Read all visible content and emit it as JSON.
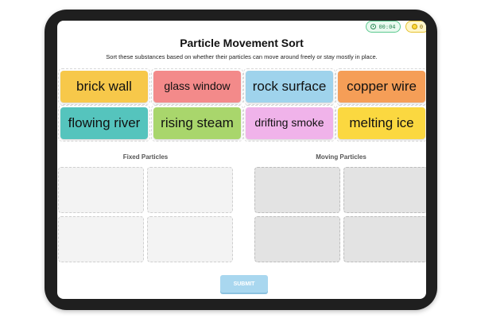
{
  "header": {
    "timer": "00:04",
    "coins": "0",
    "title": "Particle Movement Sort",
    "subtitle": "Sort these substances based on whether their particles can move around freely or stay mostly in place."
  },
  "cards": [
    {
      "label": "brick wall",
      "color": "#f7c84a"
    },
    {
      "label": "glass window",
      "color": "#f38a8a"
    },
    {
      "label": "rock surface",
      "color": "#9fd3ec"
    },
    {
      "label": "copper wire",
      "color": "#f59e57"
    },
    {
      "label": "flowing river",
      "color": "#55c4bd"
    },
    {
      "label": "rising steam",
      "color": "#a9d66c"
    },
    {
      "label": "drifting smoke",
      "color": "#f0b3ea"
    },
    {
      "label": "melting ice",
      "color": "#fbd840"
    }
  ],
  "zones": {
    "fixed_label": "Fixed Particles",
    "moving_label": "Moving Particles"
  },
  "submit_label": "SUBMIT",
  "colors": {
    "timer_border": "#5cc98f",
    "coin_border": "#e6c22f",
    "submit_bg": "#a9d7ef"
  }
}
